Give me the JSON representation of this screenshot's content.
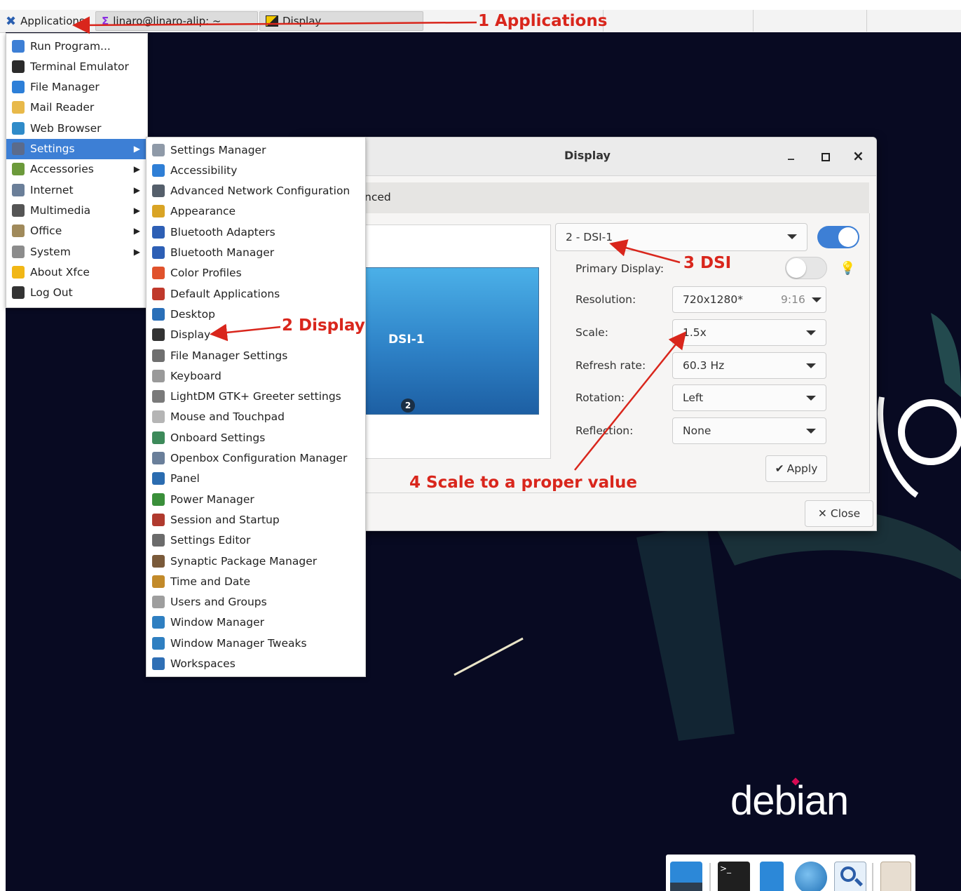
{
  "panel": {
    "applications_label": "Applications",
    "task1_label": "linaro@linaro-alip: ~",
    "task2_label": "Display"
  },
  "app_menu": {
    "items": [
      {
        "label": "Run Program...",
        "icon": "search-icon",
        "color": "#3d7fd5"
      },
      {
        "label": "Terminal Emulator",
        "icon": "terminal-icon",
        "color": "#2b2b2b"
      },
      {
        "label": "File Manager",
        "icon": "file-manager-icon",
        "color": "#2d7fd8"
      },
      {
        "label": "Mail Reader",
        "icon": "mail-icon",
        "color": "#e8b94a"
      },
      {
        "label": "Web Browser",
        "icon": "globe-icon",
        "color": "#2f8bc9"
      },
      {
        "label": "Settings",
        "icon": "settings-icon",
        "color": "#5b6b8c",
        "submenu": true
      },
      {
        "label": "Accessories",
        "icon": "accessories-icon",
        "color": "#6c9a3b",
        "submenu": true
      },
      {
        "label": "Internet",
        "icon": "internet-icon",
        "color": "#6b7f99",
        "submenu": true
      },
      {
        "label": "Multimedia",
        "icon": "multimedia-icon",
        "color": "#555555",
        "submenu": true
      },
      {
        "label": "Office",
        "icon": "office-icon",
        "color": "#a08a5b",
        "submenu": true
      },
      {
        "label": "System",
        "icon": "system-icon",
        "color": "#8c8c8c",
        "submenu": true
      },
      {
        "label": "About Xfce",
        "icon": "star-icon",
        "color": "#f1b716"
      },
      {
        "label": "Log Out",
        "icon": "logout-icon",
        "color": "#333333"
      }
    ]
  },
  "settings_menu": {
    "items": [
      {
        "label": "Settings Manager",
        "icon": "settings-manager-icon",
        "color": "#8f9aa8"
      },
      {
        "label": "Accessibility",
        "icon": "accessibility-icon",
        "color": "#2f7fd6"
      },
      {
        "label": "Advanced Network Configuration",
        "icon": "network-icon",
        "color": "#555f6b"
      },
      {
        "label": "Appearance",
        "icon": "appearance-icon",
        "color": "#d9a425"
      },
      {
        "label": "Bluetooth Adapters",
        "icon": "bluetooth-adapter-icon",
        "color": "#2d5fb5"
      },
      {
        "label": "Bluetooth Manager",
        "icon": "bluetooth-icon",
        "color": "#2d5fb5"
      },
      {
        "label": "Color Profiles",
        "icon": "color-profiles-icon",
        "color": "#e0522c"
      },
      {
        "label": "Default Applications",
        "icon": "default-apps-icon",
        "color": "#c0392b"
      },
      {
        "label": "Desktop",
        "icon": "desktop-icon",
        "color": "#2a6fb8"
      },
      {
        "label": "Display",
        "icon": "display-icon",
        "color": "#333333"
      },
      {
        "label": "File Manager Settings",
        "icon": "file-manager-settings-icon",
        "color": "#6f6f6f"
      },
      {
        "label": "Keyboard",
        "icon": "keyboard-icon",
        "color": "#9a9a9a"
      },
      {
        "label": "LightDM GTK+ Greeter settings",
        "icon": "lightdm-icon",
        "color": "#7a7a7a"
      },
      {
        "label": "Mouse and Touchpad",
        "icon": "mouse-icon",
        "color": "#b5b5b5"
      },
      {
        "label": "Onboard Settings",
        "icon": "onboard-icon",
        "color": "#3d8a5a"
      },
      {
        "label": "Openbox Configuration Manager",
        "icon": "openbox-icon",
        "color": "#6a7f9a"
      },
      {
        "label": "Panel",
        "icon": "panel-icon",
        "color": "#2b6cb0"
      },
      {
        "label": "Power Manager",
        "icon": "power-icon",
        "color": "#3a8f3a"
      },
      {
        "label": "Session and Startup",
        "icon": "rocket-icon",
        "color": "#b03a2e"
      },
      {
        "label": "Settings Editor",
        "icon": "code-icon",
        "color": "#6b6b6b"
      },
      {
        "label": "Synaptic Package Manager",
        "icon": "package-icon",
        "color": "#7a5a3a"
      },
      {
        "label": "Time and Date",
        "icon": "clock-icon",
        "color": "#c28a2a"
      },
      {
        "label": "Users and Groups",
        "icon": "users-icon",
        "color": "#9e9e9e"
      },
      {
        "label": "Window Manager",
        "icon": "window-manager-icon",
        "color": "#2f7fc1"
      },
      {
        "label": "Window Manager Tweaks",
        "icon": "window-tweaks-icon",
        "color": "#2f7fc1"
      },
      {
        "label": "Workspaces",
        "icon": "workspaces-icon",
        "color": "#2f6fb5"
      }
    ]
  },
  "dialog": {
    "title": "Display",
    "tab_partial": "nced",
    "monitor_name": "DSI-1",
    "monitor_badge": "2",
    "display_select": "2 - DSI-1",
    "primary_label": "Primary Display:",
    "resolution_label": "Resolution:",
    "resolution_value": "720x1280*",
    "resolution_ratio": "9:16",
    "scale_label": "Scale:",
    "scale_value": "1.5x",
    "refresh_label": "Refresh rate:",
    "refresh_value": "60.3 Hz",
    "rotation_label": "Rotation:",
    "rotation_value": "Left",
    "reflection_label": "Reflection:",
    "reflection_value": "None",
    "apply_label": "Apply",
    "close_label": "Close",
    "minimize_glyph": "_",
    "maximize_glyph": "▫",
    "close_glyph": "×"
  },
  "annotations": {
    "a1": "1 Applications",
    "a2": "2 Display",
    "a3": "3 DSI",
    "a4": "4 Scale to a proper value",
    "color": "#d9261c"
  },
  "desktop": {
    "logo_text": "debian",
    "background": "#080a22"
  }
}
